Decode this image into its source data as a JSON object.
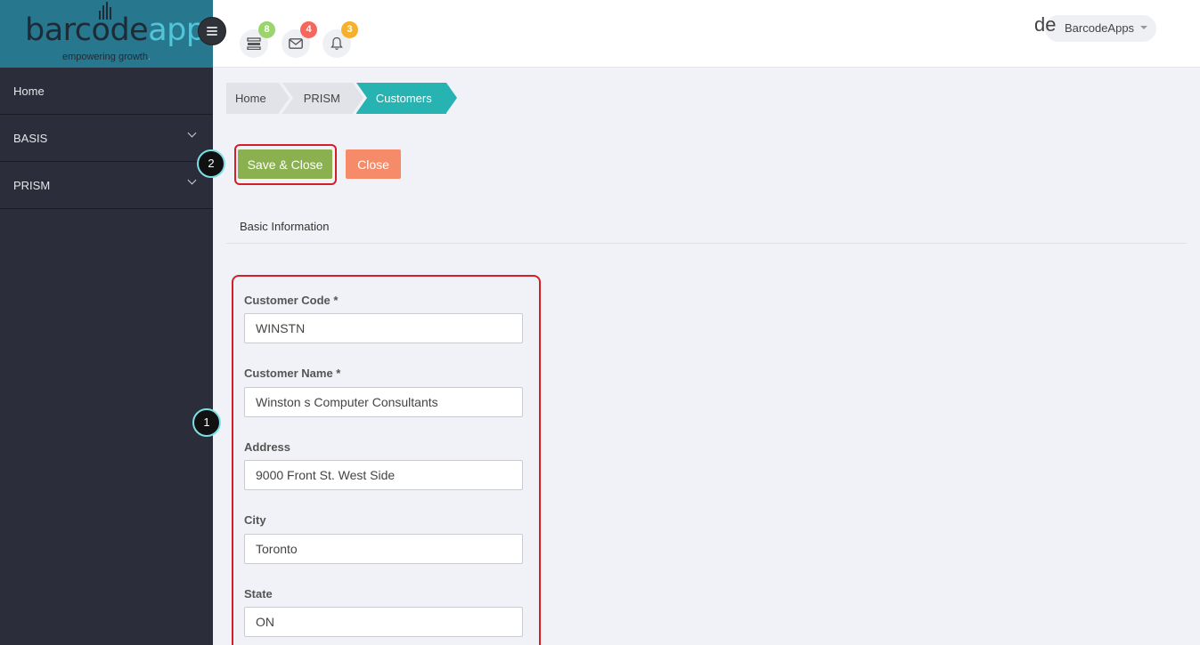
{
  "logo": {
    "brand_part1": "barcode",
    "brand_part2": "apps",
    "tagline": "empowering growth",
    "tagline_dot": "."
  },
  "sidebar": {
    "items": [
      {
        "label": "Home",
        "has_submenu": false
      },
      {
        "label": "BASIS",
        "has_submenu": true
      },
      {
        "label": "PRISM",
        "has_submenu": true
      }
    ]
  },
  "header": {
    "icons": [
      {
        "icon": "tasks-icon",
        "badge": "8",
        "badge_color": "#9bd36d"
      },
      {
        "icon": "envelope-icon",
        "badge": "4",
        "badge_color": "#f5675c"
      },
      {
        "icon": "bell-icon",
        "badge": "3",
        "badge_color": "#f5b12a"
      }
    ],
    "user_prefix": "de",
    "user_name": "BarcodeApps"
  },
  "breadcrumb": [
    "Home",
    "PRISM",
    "Customers"
  ],
  "toolbar": {
    "save_label": "Save & Close",
    "close_label": "Close"
  },
  "callouts": [
    "1",
    "2"
  ],
  "section": {
    "title": "Basic Information"
  },
  "form": {
    "fields": [
      {
        "label": "Customer Code *",
        "value": "WINSTN"
      },
      {
        "label": "Customer Name *",
        "value": "Winston s Computer Consultants"
      },
      {
        "label": "Address",
        "value": "9000 Front St. West Side"
      },
      {
        "label": "City",
        "value": "Toronto"
      },
      {
        "label": "State",
        "value": "ON"
      }
    ]
  },
  "colors": {
    "sidebar_bg": "#2b2e3a",
    "logo_bg": "#27788f",
    "accent_teal": "#27b3b2",
    "save_green": "#8ab04f",
    "close_orange": "#f58b68",
    "highlight_red": "#d21f2a"
  }
}
